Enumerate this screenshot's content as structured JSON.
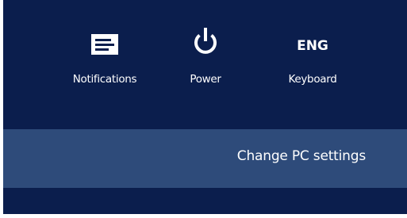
{
  "quick_settings": [
    {
      "icon": "notifications-icon",
      "label": "Notifications"
    },
    {
      "icon": "power-icon",
      "label": "Power"
    },
    {
      "icon": "keyboard-language-icon",
      "icon_text": "ENG",
      "label": "Keyboard"
    }
  ],
  "settings_link": {
    "label": "Change PC settings"
  },
  "colors": {
    "panel_background": "#0b1e4d",
    "settings_band": "#2e4b7a",
    "text": "#ffffff"
  }
}
